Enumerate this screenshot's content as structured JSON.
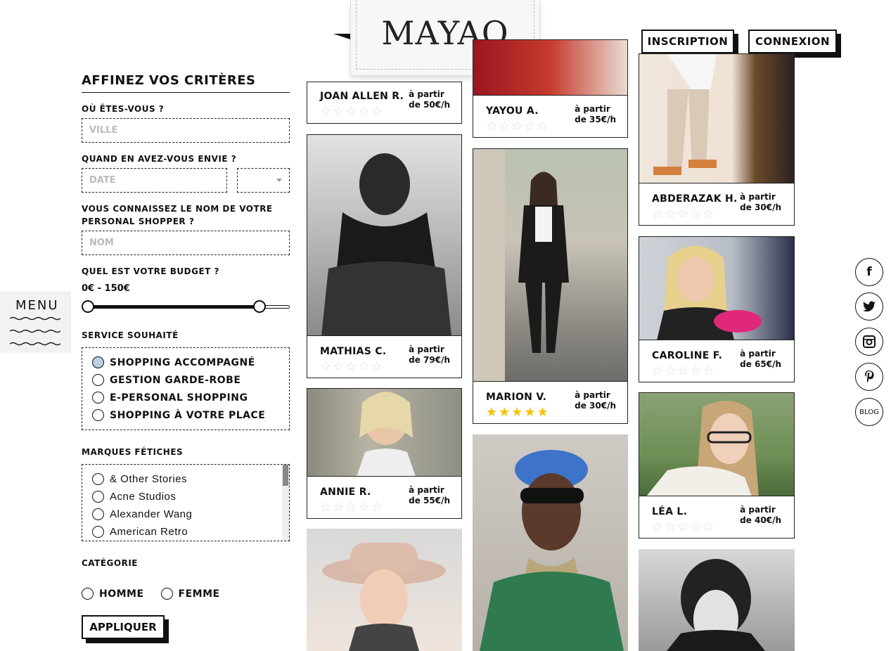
{
  "brand": {
    "logo": "MAYAO"
  },
  "header": {
    "signup": "INSCRIPTION",
    "login": "CONNEXION"
  },
  "menu": {
    "label": "MENU"
  },
  "filters": {
    "title": "AFFINEZ VOS CRITÈRES",
    "where_label": "OÙ ÊTES-VOUS ?",
    "city_placeholder": "VILLE",
    "when_label": "QUAND EN AVEZ-VOUS ENVIE ?",
    "date_placeholder": "DATE",
    "shopper_label": "VOUS CONNAISSEZ LE NOM DE VOTRE PERSONAL SHOPPER ?",
    "name_placeholder": "NOM",
    "budget_label": "QUEL EST VOTRE BUDGET ?",
    "budget_value": "0€ - 150€",
    "budget_min": 0,
    "budget_max": 150,
    "service_label": "SERVICE SOUHAITÉ",
    "services": [
      "SHOPPING ACCOMPAGNÉ",
      "GESTION GARDE-ROBE",
      "E-PERSONAL SHOPPING",
      "SHOPPING À VOTRE PLACE"
    ],
    "service_selected": "SHOPPING ACCOMPAGNÉ",
    "brands_label": "MARQUES FÉTICHES",
    "brands": [
      "& Other Stories",
      "Acne Studios",
      "Alexander Wang",
      "American Retro"
    ],
    "category_label": "CATÉGORIE",
    "categories": [
      "HOMME",
      "FEMME"
    ],
    "apply": "APPLIQUER"
  },
  "shoppers": [
    {
      "name": "JOAN ALLEN R.",
      "price_prefix": "à partir",
      "price": "de 50€/h",
      "rating": 0
    },
    {
      "name": "MATHIAS C.",
      "price_prefix": "à partir",
      "price": "de 79€/h",
      "rating": 0
    },
    {
      "name": "ANNIE R.",
      "price_prefix": "à partir",
      "price": "de 55€/h",
      "rating": 0
    },
    {
      "name": "YAYOU A.",
      "price_prefix": "à partir",
      "price": "de 35€/h",
      "rating": 0
    },
    {
      "name": "MARION V.",
      "price_prefix": "à partir",
      "price": "de 30€/h",
      "rating": 5
    },
    {
      "name": "ABDERAZAK H.",
      "price_prefix": "à partir",
      "price": "de 30€/h",
      "rating": 0
    },
    {
      "name": "CAROLINE F.",
      "price_prefix": "à partir",
      "price": "de 65€/h",
      "rating": 0
    },
    {
      "name": "LÉA L.",
      "price_prefix": "à partir",
      "price": "de 40€/h",
      "rating": 0
    }
  ],
  "social": {
    "blog": "BLOG",
    "facebook": "f",
    "twitter": "t",
    "instagram": "◎",
    "pinterest": "p"
  }
}
